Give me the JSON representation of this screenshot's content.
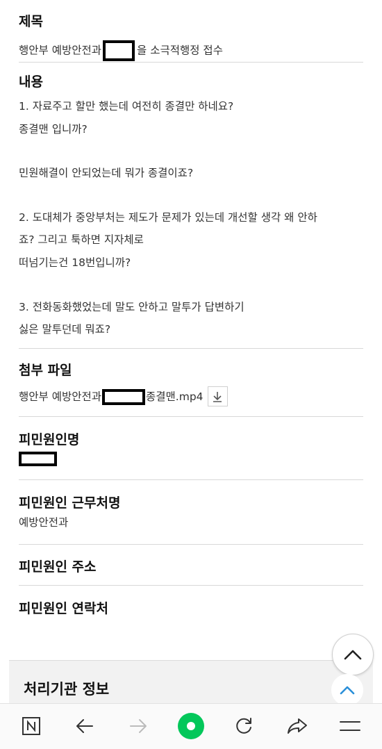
{
  "sections": {
    "title": {
      "label": "제목",
      "value_prefix": "행안부 예방안전과",
      "value_suffix": "을 소극적행정 접수"
    },
    "body": {
      "label": "내용",
      "lines": [
        "1. 자료주고 할만 했는데 여전히 종결만 하네요?",
        "종결맨 입니까?",
        "",
        "민원해결이 안되었는데 뭐가 종결이죠?",
        "",
        "2. 도대체가 중앙부처는 제도가 문제가 있는데 개선할 생각 왜 안하",
        "죠?  그리고 툭하면 지자체로",
        "떠넘기는건 18번입니까?",
        "",
        "3. 전화동화했었는데 말도 안하고  말투가 답변하기",
        "싫은 말투던데 뭐죠?"
      ]
    },
    "attachment": {
      "label": "첨부 파일",
      "file_prefix": "행안부 예방안전과",
      "file_suffix": "종결맨.mp4"
    },
    "respondent_name": {
      "label": "피민원인명"
    },
    "respondent_workplace": {
      "label": "피민원인 근무처명",
      "value": "예방안전과"
    },
    "respondent_address": {
      "label": "피민원인 주소"
    },
    "respondent_contact": {
      "label": "피민원인 연락처"
    }
  },
  "agency_panel": {
    "label": "처리기관 정보"
  },
  "colors": {
    "accent_blue": "#2a8fd8",
    "naver_green": "#03c75a"
  },
  "navbar": {
    "items": [
      {
        "name": "naver-home",
        "icon": "n-logo-icon"
      },
      {
        "name": "back",
        "icon": "arrow-left-icon"
      },
      {
        "name": "forward",
        "icon": "arrow-right-icon"
      },
      {
        "name": "green-dot",
        "icon": "green-dot-icon"
      },
      {
        "name": "refresh",
        "icon": "refresh-icon"
      },
      {
        "name": "share",
        "icon": "share-icon"
      },
      {
        "name": "menu",
        "icon": "hamburger-menu-icon"
      }
    ]
  }
}
